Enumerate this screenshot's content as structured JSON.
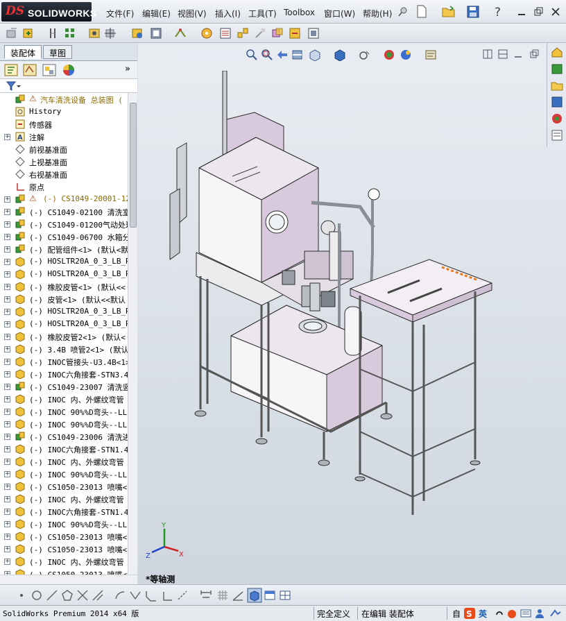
{
  "app": {
    "logo_prefix": "DS",
    "logo_text": "SOLIDWORKS"
  },
  "menu": [
    "文件(F)",
    "编辑(E)",
    "视图(V)",
    "插入(I)",
    "工具(T)",
    "Toolbox",
    "窗口(W)",
    "帮助(H)"
  ],
  "panel": {
    "tabs": [
      "装配体",
      "草图"
    ],
    "expand_chevron": "»"
  },
  "tree": {
    "root": "汽车清洗设备   总装图   (",
    "items": [
      {
        "label": "History",
        "icon": "history-icon",
        "expand": false,
        "warn": false
      },
      {
        "label": "传感器",
        "icon": "sensor-icon",
        "expand": false,
        "warn": false
      },
      {
        "label": "注解",
        "icon": "annotation-icon",
        "expand": true,
        "warn": false
      },
      {
        "label": "前视基准面",
        "icon": "plane-icon",
        "expand": false,
        "warn": false
      },
      {
        "label": "上视基准面",
        "icon": "plane-icon",
        "expand": false,
        "warn": false
      },
      {
        "label": "右视基准面",
        "icon": "plane-icon",
        "expand": false,
        "warn": false
      },
      {
        "label": "原点",
        "icon": "origin-icon",
        "expand": false,
        "warn": false
      },
      {
        "label": "(-) CS1049-20001-12 ",
        "icon": "subassembly-icon",
        "expand": true,
        "warn": true
      },
      {
        "label": "(-) CS1049-02100 清洗室",
        "icon": "subassembly-icon",
        "expand": true,
        "warn": false
      },
      {
        "label": "(-) CS1049-01200气动处理",
        "icon": "subassembly-icon",
        "expand": true,
        "warn": false
      },
      {
        "label": "(-) CS1049-06700 水箱分",
        "icon": "subassembly-icon",
        "expand": true,
        "warn": false
      },
      {
        "label": "(-) 配管组件<1> (默认<默",
        "icon": "subassembly-icon",
        "expand": true,
        "warn": false
      },
      {
        "label": "(-) HOSLTR20A_0_3_LB_RB",
        "icon": "part-icon",
        "expand": true,
        "warn": false
      },
      {
        "label": "(-) HOSLTR20A_0_3_LB_RB",
        "icon": "part-icon",
        "expand": true,
        "warn": false
      },
      {
        "label": "(-) 橡胶皮管<1> (默认<<",
        "icon": "part-icon",
        "expand": true,
        "warn": false
      },
      {
        "label": "(-) 皮管<1> (默认<<默认",
        "icon": "part-icon",
        "expand": true,
        "warn": false
      },
      {
        "label": "(-) HOSLTR20A_0_3_LB_RB",
        "icon": "part-icon",
        "expand": true,
        "warn": false
      },
      {
        "label": "(-) HOSLTR20A_0_3_LB_RB",
        "icon": "part-icon",
        "expand": true,
        "warn": false
      },
      {
        "label": "(-) 橡胶皮管2<1> (默认<",
        "icon": "part-icon",
        "expand": true,
        "warn": false
      },
      {
        "label": "(-) 3.4B 喷管2<1> (默认",
        "icon": "part-icon",
        "expand": true,
        "warn": false
      },
      {
        "label": "(-) INOC管接头-U3.4B<1>",
        "icon": "part-icon",
        "expand": true,
        "warn": false
      },
      {
        "label": "(-) INOC六角接套-STN3.4",
        "icon": "part-icon",
        "expand": true,
        "warn": false
      },
      {
        "label": "(-) CS1049-23007 清洗竖",
        "icon": "subassembly-icon",
        "expand": true,
        "warn": false
      },
      {
        "label": "(-) INOC 内、外螺纹弯管",
        "icon": "part-icon",
        "expand": true,
        "warn": false
      },
      {
        "label": "(-) INOC 90%%D弯头--LL",
        "icon": "part-icon",
        "expand": true,
        "warn": false
      },
      {
        "label": "(-) INOC 90%%D弯头--LL",
        "icon": "part-icon",
        "expand": true,
        "warn": false
      },
      {
        "label": "(-) CS1049-23006 清洗进",
        "icon": "subassembly-icon",
        "expand": true,
        "warn": false
      },
      {
        "label": "(-) INOC六角接套-STN1.4",
        "icon": "part-icon",
        "expand": true,
        "warn": false
      },
      {
        "label": "(-) INOC 内、外螺纹弯管",
        "icon": "part-icon",
        "expand": true,
        "warn": false
      },
      {
        "label": "(-) INOC 90%%D弯头--LL",
        "icon": "part-icon",
        "expand": true,
        "warn": false
      },
      {
        "label": "(-) CS1050-23013 喷嘴<1",
        "icon": "part-icon",
        "expand": true,
        "warn": false
      },
      {
        "label": "(-) INOC 内、外螺纹弯管",
        "icon": "part-icon",
        "expand": true,
        "warn": false
      },
      {
        "label": "(-) INOC六角接套-STN1.4",
        "icon": "part-icon",
        "expand": true,
        "warn": false
      },
      {
        "label": "(-) INOC 90%%D弯头--LL",
        "icon": "part-icon",
        "expand": true,
        "warn": false
      },
      {
        "label": "(-) CS1050-23013 喷嘴<2",
        "icon": "part-icon",
        "expand": true,
        "warn": false
      },
      {
        "label": "(-) CS1050-23013 喷嘴<3",
        "icon": "part-icon",
        "expand": true,
        "warn": false
      },
      {
        "label": "(-) INOC 内、外螺纹弯管",
        "icon": "part-icon",
        "expand": true,
        "warn": false
      },
      {
        "label": "(-) CS1050-23013 喷嘴<4",
        "icon": "part-icon",
        "expand": true,
        "warn": false
      }
    ]
  },
  "viewport": {
    "view_label": "*等轴测",
    "triad": {
      "x": "X",
      "y": "Y",
      "z": "Z"
    }
  },
  "status": {
    "product": "SolidWorks Premium 2014 x64 版",
    "definition": "完全定义",
    "mode": "在编辑 装配体",
    "custom": "自",
    "ime_label": "英"
  },
  "colors": {
    "frame": "#c9ced4",
    "panel_tint": "#d9c9dd",
    "panel_dark": "#b9a6bf",
    "accent_orange": "#e8781a"
  }
}
